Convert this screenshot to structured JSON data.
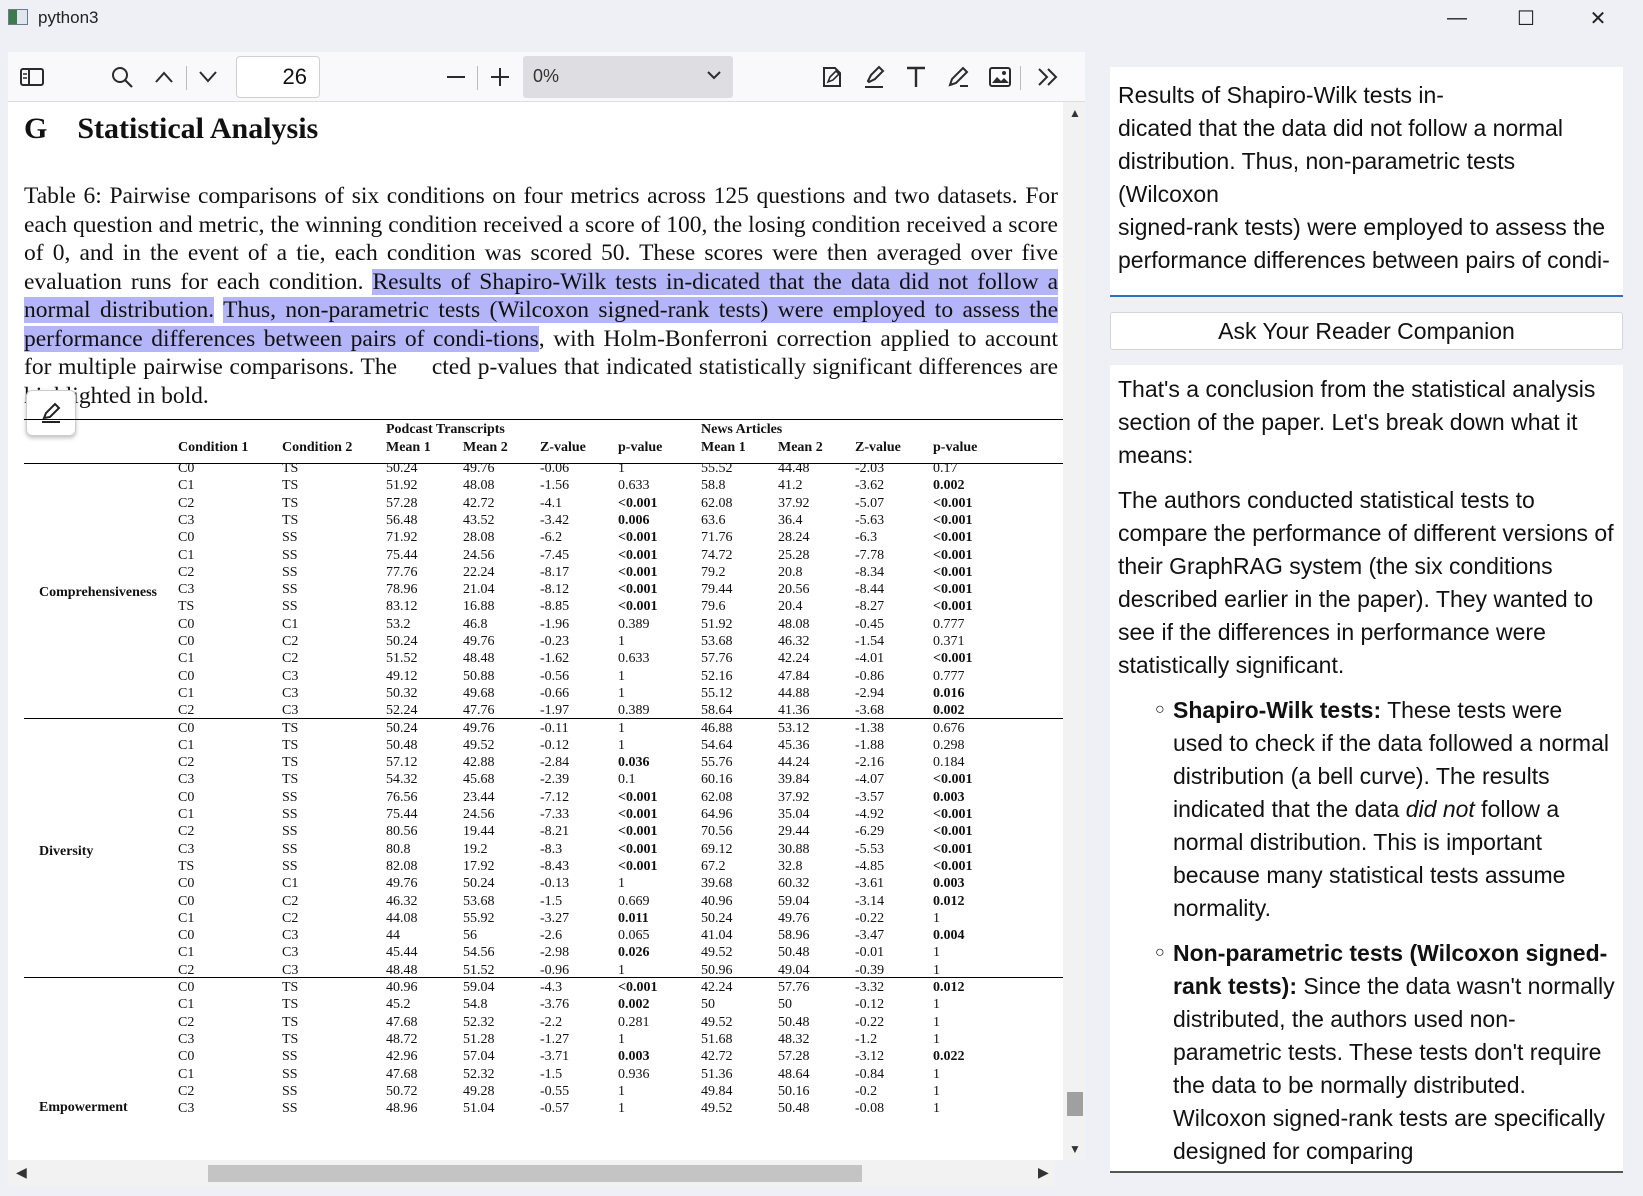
{
  "window": {
    "title": "python3",
    "minimize": "—",
    "maximize": "☐",
    "close": "✕"
  },
  "toolbar": {
    "page_number": "26",
    "zoom_value": "0%",
    "icons": [
      "sidebar-toggle-icon",
      "search-icon",
      "chevron-up-icon",
      "chevron-down-icon",
      "zoom-out-icon",
      "zoom-in-icon",
      "edit-doc-icon",
      "highlight-icon",
      "text-icon",
      "draw-icon",
      "image-icon",
      "more-tools-icon"
    ]
  },
  "document": {
    "section_label": "G",
    "section_title": "Statistical Analysis",
    "caption_before": "Table 6: Pairwise comparisons of six conditions on four metrics across 125 questions and two datasets. For each question and metric, the winning condition received a score of 100, the losing condition received a score of 0, and in the event of a tie, each condition was scored 50. These scores were then averaged over five evaluation runs for each condition. ",
    "caption_highlight_1": "Results of Shapiro-Wilk tests in-dicated that the data did not follow a normal distribution.",
    "caption_between": " ",
    "caption_highlight_2": "Thus, non-parametric tests (Wilcoxon signed-rank tests) were employed to assess the performance differences between pairs of condi-tions",
    "caption_after": ", with Holm-Bonferroni correction applied to account for multiple pairwise comparisons. The ",
    "caption_tail": "cted p-values that indicated statistically significant differences are highlighted in bold.",
    "table": {
      "group_headers": [
        "Podcast Transcripts",
        "News Articles"
      ],
      "columns": [
        "Condition 1",
        "Condition 2",
        "Mean 1",
        "Mean 2",
        "Z-value",
        "p-value",
        "Mean 1",
        "Mean 2",
        "Z-value",
        "p-value"
      ],
      "metrics": [
        {
          "name": "Comprehensiveness",
          "rows": [
            [
              "C0",
              "TS",
              "50.24",
              "49.76",
              "-0.06",
              "1",
              "55.52",
              "44.48",
              "-2.03",
              "0.17"
            ],
            [
              "C1",
              "TS",
              "51.92",
              "48.08",
              "-1.56",
              "0.633",
              "58.8",
              "41.2",
              "-3.62",
              "0.002"
            ],
            [
              "C2",
              "TS",
              "57.28",
              "42.72",
              "-4.1",
              "<0.001",
              "62.08",
              "37.92",
              "-5.07",
              "<0.001"
            ],
            [
              "C3",
              "TS",
              "56.48",
              "43.52",
              "-3.42",
              "0.006",
              "63.6",
              "36.4",
              "-5.63",
              "<0.001"
            ],
            [
              "C0",
              "SS",
              "71.92",
              "28.08",
              "-6.2",
              "<0.001",
              "71.76",
              "28.24",
              "-6.3",
              "<0.001"
            ],
            [
              "C1",
              "SS",
              "75.44",
              "24.56",
              "-7.45",
              "<0.001",
              "74.72",
              "25.28",
              "-7.78",
              "<0.001"
            ],
            [
              "C2",
              "SS",
              "77.76",
              "22.24",
              "-8.17",
              "<0.001",
              "79.2",
              "20.8",
              "-8.34",
              "<0.001"
            ],
            [
              "C3",
              "SS",
              "78.96",
              "21.04",
              "-8.12",
              "<0.001",
              "79.44",
              "20.56",
              "-8.44",
              "<0.001"
            ],
            [
              "TS",
              "SS",
              "83.12",
              "16.88",
              "-8.85",
              "<0.001",
              "79.6",
              "20.4",
              "-8.27",
              "<0.001"
            ],
            [
              "C0",
              "C1",
              "53.2",
              "46.8",
              "-1.96",
              "0.389",
              "51.92",
              "48.08",
              "-0.45",
              "0.777"
            ],
            [
              "C0",
              "C2",
              "50.24",
              "49.76",
              "-0.23",
              "1",
              "53.68",
              "46.32",
              "-1.54",
              "0.371"
            ],
            [
              "C1",
              "C2",
              "51.52",
              "48.48",
              "-1.62",
              "0.633",
              "57.76",
              "42.24",
              "-4.01",
              "<0.001"
            ],
            [
              "C0",
              "C3",
              "49.12",
              "50.88",
              "-0.56",
              "1",
              "52.16",
              "47.84",
              "-0.86",
              "0.777"
            ],
            [
              "C1",
              "C3",
              "50.32",
              "49.68",
              "-0.66",
              "1",
              "55.12",
              "44.88",
              "-2.94",
              "0.016"
            ],
            [
              "C2",
              "C3",
              "52.24",
              "47.76",
              "-1.97",
              "0.389",
              "58.64",
              "41.36",
              "-3.68",
              "0.002"
            ]
          ]
        },
        {
          "name": "Diversity",
          "rows": [
            [
              "C0",
              "TS",
              "50.24",
              "49.76",
              "-0.11",
              "1",
              "46.88",
              "53.12",
              "-1.38",
              "0.676"
            ],
            [
              "C1",
              "TS",
              "50.48",
              "49.52",
              "-0.12",
              "1",
              "54.64",
              "45.36",
              "-1.88",
              "0.298"
            ],
            [
              "C2",
              "TS",
              "57.12",
              "42.88",
              "-2.84",
              "0.036",
              "55.76",
              "44.24",
              "-2.16",
              "0.184"
            ],
            [
              "C3",
              "TS",
              "54.32",
              "45.68",
              "-2.39",
              "0.1",
              "60.16",
              "39.84",
              "-4.07",
              "<0.001"
            ],
            [
              "C0",
              "SS",
              "76.56",
              "23.44",
              "-7.12",
              "<0.001",
              "62.08",
              "37.92",
              "-3.57",
              "0.003"
            ],
            [
              "C1",
              "SS",
              "75.44",
              "24.56",
              "-7.33",
              "<0.001",
              "64.96",
              "35.04",
              "-4.92",
              "<0.001"
            ],
            [
              "C2",
              "SS",
              "80.56",
              "19.44",
              "-8.21",
              "<0.001",
              "70.56",
              "29.44",
              "-6.29",
              "<0.001"
            ],
            [
              "C3",
              "SS",
              "80.8",
              "19.2",
              "-8.3",
              "<0.001",
              "69.12",
              "30.88",
              "-5.53",
              "<0.001"
            ],
            [
              "TS",
              "SS",
              "82.08",
              "17.92",
              "-8.43",
              "<0.001",
              "67.2",
              "32.8",
              "-4.85",
              "<0.001"
            ],
            [
              "C0",
              "C1",
              "49.76",
              "50.24",
              "-0.13",
              "1",
              "39.68",
              "60.32",
              "-3.61",
              "0.003"
            ],
            [
              "C0",
              "C2",
              "46.32",
              "53.68",
              "-1.5",
              "0.669",
              "40.96",
              "59.04",
              "-3.14",
              "0.012"
            ],
            [
              "C1",
              "C2",
              "44.08",
              "55.92",
              "-3.27",
              "0.011",
              "50.24",
              "49.76",
              "-0.22",
              "1"
            ],
            [
              "C0",
              "C3",
              "44",
              "56",
              "-2.6",
              "0.065",
              "41.04",
              "58.96",
              "-3.47",
              "0.004"
            ],
            [
              "C1",
              "C3",
              "45.44",
              "54.56",
              "-2.98",
              "0.026",
              "49.52",
              "50.48",
              "-0.01",
              "1"
            ],
            [
              "C2",
              "C3",
              "48.48",
              "51.52",
              "-0.96",
              "1",
              "50.96",
              "49.04",
              "-0.39",
              "1"
            ]
          ]
        },
        {
          "name": "Empowerment",
          "rows": [
            [
              "C0",
              "TS",
              "40.96",
              "59.04",
              "-4.3",
              "<0.001",
              "42.24",
              "57.76",
              "-3.32",
              "0.012"
            ],
            [
              "C1",
              "TS",
              "45.2",
              "54.8",
              "-3.76",
              "0.002",
              "50",
              "50",
              "-0.12",
              "1"
            ],
            [
              "C2",
              "TS",
              "47.68",
              "52.32",
              "-2.2",
              "0.281",
              "49.52",
              "50.48",
              "-0.22",
              "1"
            ],
            [
              "C3",
              "TS",
              "48.72",
              "51.28",
              "-1.27",
              "1",
              "51.68",
              "48.32",
              "-1.2",
              "1"
            ],
            [
              "C0",
              "SS",
              "42.96",
              "57.04",
              "-3.71",
              "0.003",
              "42.72",
              "57.28",
              "-3.12",
              "0.022"
            ],
            [
              "C1",
              "SS",
              "47.68",
              "52.32",
              "-1.5",
              "0.936",
              "51.36",
              "48.64",
              "-0.84",
              "1"
            ],
            [
              "C2",
              "SS",
              "50.72",
              "49.28",
              "-0.55",
              "1",
              "49.84",
              "50.16",
              "-0.2",
              "1"
            ],
            [
              "C3",
              "SS",
              "48.96",
              "51.04",
              "-0.57",
              "1",
              "49.52",
              "50.48",
              "-0.08",
              "1"
            ]
          ]
        }
      ],
      "bold_cells": {
        "Comprehensiveness": [
          [
            2,
            5
          ],
          [
            3,
            5
          ],
          [
            4,
            5
          ],
          [
            5,
            5
          ],
          [
            6,
            5
          ],
          [
            7,
            5
          ],
          [
            8,
            5
          ],
          [
            1,
            9
          ],
          [
            2,
            9
          ],
          [
            3,
            9
          ],
          [
            4,
            9
          ],
          [
            5,
            9
          ],
          [
            6,
            9
          ],
          [
            7,
            9
          ],
          [
            8,
            9
          ],
          [
            11,
            9
          ],
          [
            13,
            9
          ],
          [
            14,
            9
          ]
        ],
        "Diversity": [
          [
            2,
            5
          ],
          [
            4,
            5
          ],
          [
            5,
            5
          ],
          [
            6,
            5
          ],
          [
            7,
            5
          ],
          [
            8,
            5
          ],
          [
            11,
            5
          ],
          [
            13,
            5
          ],
          [
            3,
            9
          ],
          [
            4,
            9
          ],
          [
            5,
            9
          ],
          [
            6,
            9
          ],
          [
            7,
            9
          ],
          [
            8,
            9
          ],
          [
            9,
            9
          ],
          [
            10,
            9
          ],
          [
            12,
            9
          ]
        ],
        "Empowerment": [
          [
            0,
            5
          ],
          [
            1,
            5
          ],
          [
            4,
            5
          ],
          [
            0,
            9
          ],
          [
            4,
            9
          ]
        ]
      }
    }
  },
  "companion": {
    "selected_text": "Results of Shapiro-Wilk tests in-\ndicated that the data did not follow a normal distribution. Thus, non-parametric tests (Wilcoxon\nsigned-rank tests) were employed to assess the performance differences between pairs of condi-",
    "ask_button": "Ask Your Reader Companion",
    "answer_intro": "That's a conclusion from the statistical analysis section of the paper.  Let's break down what it means:",
    "answer_para": "The authors conducted statistical tests to compare the performance of different versions of their GraphRAG system (the six conditions described earlier in the paper). They wanted to see if the differences in performance were statistically significant.",
    "bullet1_term": "Shapiro-Wilk tests:",
    "bullet1_text_a": " These tests were used to check if the data followed a normal distribution (a bell curve).  The results indicated that the data ",
    "bullet1_emph": "did not",
    "bullet1_text_b": " follow a normal distribution.  This is important because many statistical tests assume normality.",
    "bullet2_term": "Non-parametric tests (Wilcoxon signed-rank tests):",
    "bullet2_text": " Since the data wasn't normally distributed, the authors used non-parametric tests. These tests don't require the data to be normally distributed.  Wilcoxon signed-rank tests are specifically designed for comparing"
  },
  "colors": {
    "highlight": "#b4b4f8",
    "accent_line": "#2f6fbf",
    "chrome_bg": "#eef0f5"
  }
}
